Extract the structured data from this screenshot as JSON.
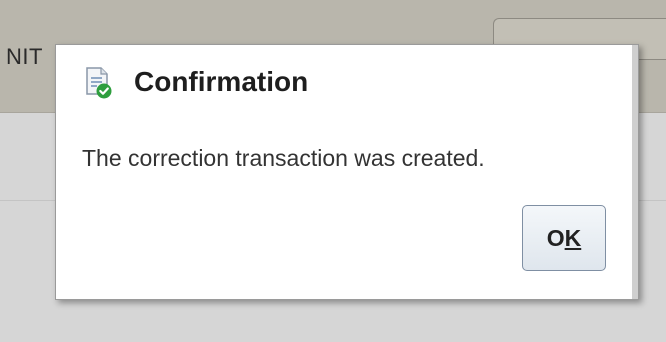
{
  "background": {
    "header_text": "NIT"
  },
  "dialog": {
    "icon": "document-check-icon",
    "title": "Confirmation",
    "message": "The correction transaction was created.",
    "ok_button": {
      "label_prefix": "O",
      "label_accel": "K"
    }
  },
  "colors": {
    "icon_check": "#2e9e3e",
    "overlay_header": "#b9b6ac"
  }
}
